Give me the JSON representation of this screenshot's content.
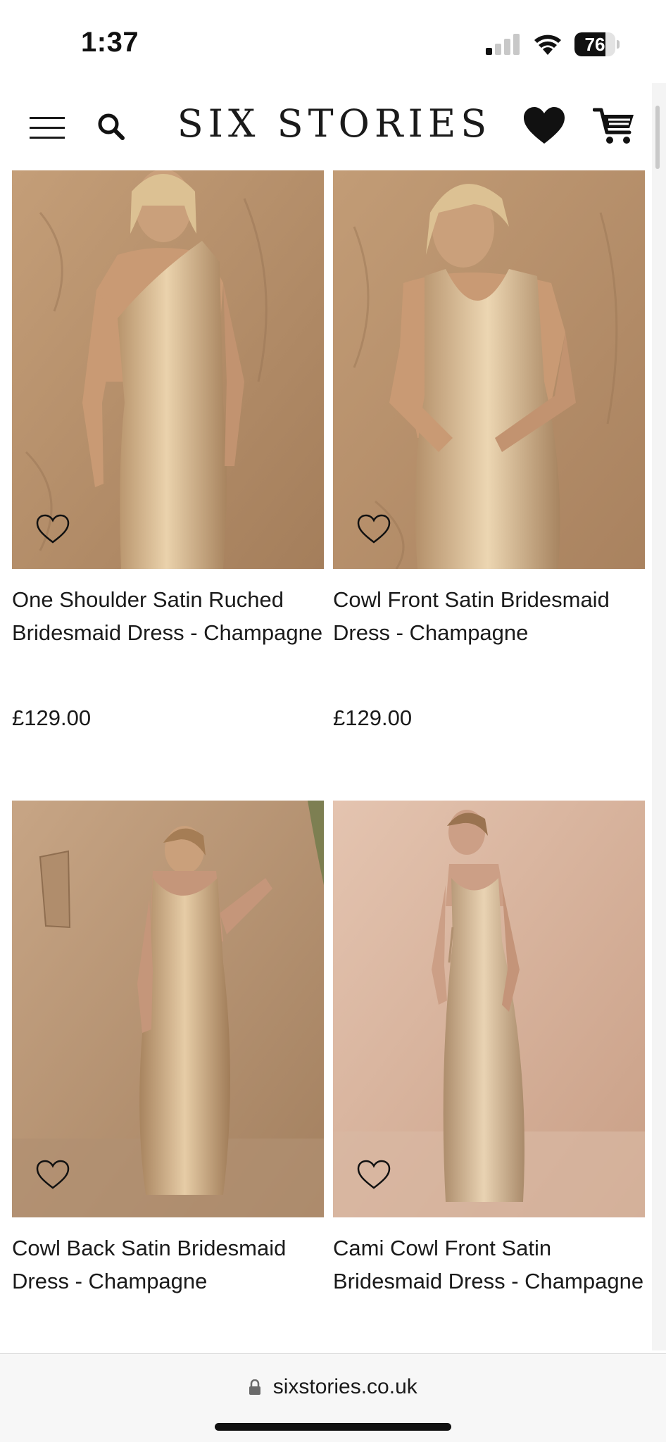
{
  "status_bar": {
    "time": "1:37",
    "battery_percent": "76",
    "battery_level": 0.76,
    "signal_bars_active": 1,
    "signal_bars_total": 4
  },
  "header": {
    "brand": "SIX STORIES",
    "icons": [
      "hamburger-menu-icon",
      "search-icon",
      "heart-icon",
      "cart-icon"
    ]
  },
  "products": [
    {
      "title": "One Shoulder Satin Ruched Bridesmaid Dress - Champagne",
      "price": "£129.00",
      "image_palette": {
        "wall": "#b48f6a",
        "dress": "#cfb08a",
        "skin": "#c99a74"
      }
    },
    {
      "title": "Cowl Front Satin Bridesmaid Dress - Champagne",
      "price": "£129.00",
      "image_palette": {
        "wall": "#b58d69",
        "dress": "#d1b38f",
        "skin": "#c99a74"
      }
    },
    {
      "title": "Cowl Back Satin Bridesmaid Dress - Champagne",
      "price": "",
      "image_palette": {
        "wall": "#b39071",
        "dress": "#c9ab87",
        "skin": "#c5967a"
      }
    },
    {
      "title": "Cami Cowl Front Satin Bridesmaid Dress - Champagne",
      "price": "",
      "image_palette": {
        "wall": "#d9b6a0",
        "dress": "#cdb091",
        "skin": "#cc9f86"
      }
    }
  ],
  "browser": {
    "url": "sixstories.co.uk"
  }
}
